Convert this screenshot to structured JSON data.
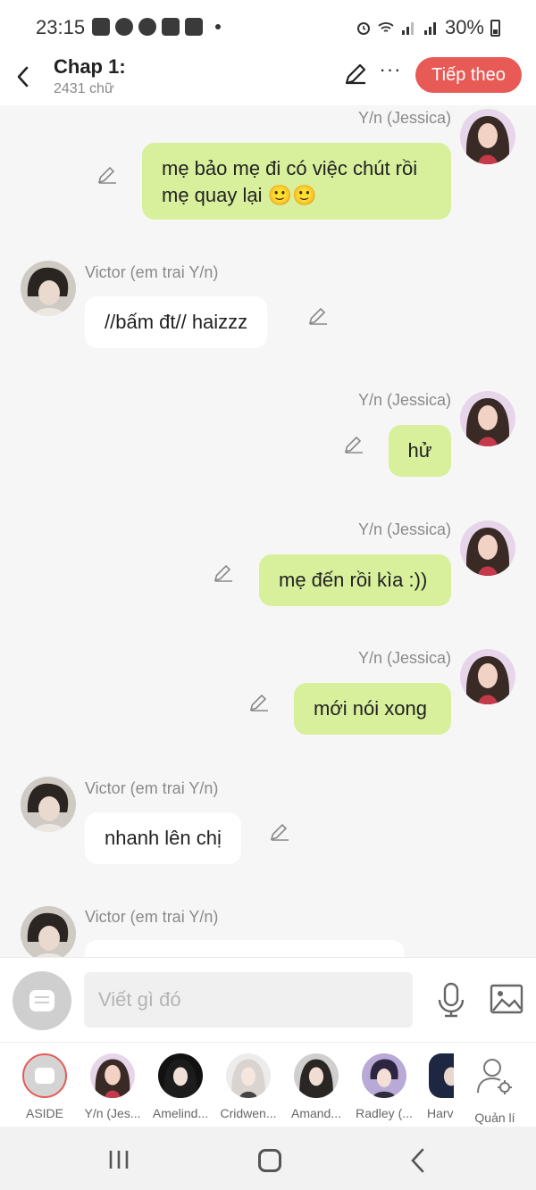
{
  "status_bar": {
    "time": "23:15",
    "apps": [
      "zalo-icon",
      "messenger-icon",
      "facebook-icon",
      "capcut-icon",
      "capcut-icon"
    ],
    "battery": "30%"
  },
  "header": {
    "title": "Chap 1:",
    "word_count": "2431 chữ",
    "next_label": "Tiếp theo"
  },
  "messages": [
    {
      "sender": "Y/n (Jessica)",
      "side": "right",
      "text_lines": [
        "mẹ bảo mẹ đi có việc chút rồi",
        "mẹ quay lại 🙂🙂"
      ]
    },
    {
      "sender": "Victor (em trai Y/n)",
      "side": "left",
      "text_lines": [
        "//bấm đt// haizzz"
      ]
    },
    {
      "sender": "Y/n (Jessica)",
      "side": "right",
      "text_lines": [
        "hử"
      ]
    },
    {
      "sender": "Y/n (Jessica)",
      "side": "right",
      "text_lines": [
        "mẹ đến rồi kìa :))"
      ]
    },
    {
      "sender": "Y/n (Jessica)",
      "side": "right",
      "text_lines": [
        "mới nói xong"
      ]
    },
    {
      "sender": "Victor (em trai Y/n)",
      "side": "left",
      "text_lines": [
        "nhanh lên chị"
      ]
    },
    {
      "sender": "Victor (em trai Y/n)",
      "side": "left",
      "text_lines": [
        ""
      ]
    }
  ],
  "input": {
    "placeholder": "Viết gì đó"
  },
  "characters": [
    {
      "label": "ASIDE"
    },
    {
      "label": "Y/n (Jes..."
    },
    {
      "label": "Amelind..."
    },
    {
      "label": "Cridwen..."
    },
    {
      "label": "Amand..."
    },
    {
      "label": "Radley (..."
    },
    {
      "label": "Harv"
    },
    {
      "label": "Quản lí"
    }
  ],
  "colors": {
    "accent": "#e85a55",
    "my_bubble": "#d8f09c",
    "other_bubble": "#ffffff",
    "chat_bg": "#f6f6f6"
  }
}
